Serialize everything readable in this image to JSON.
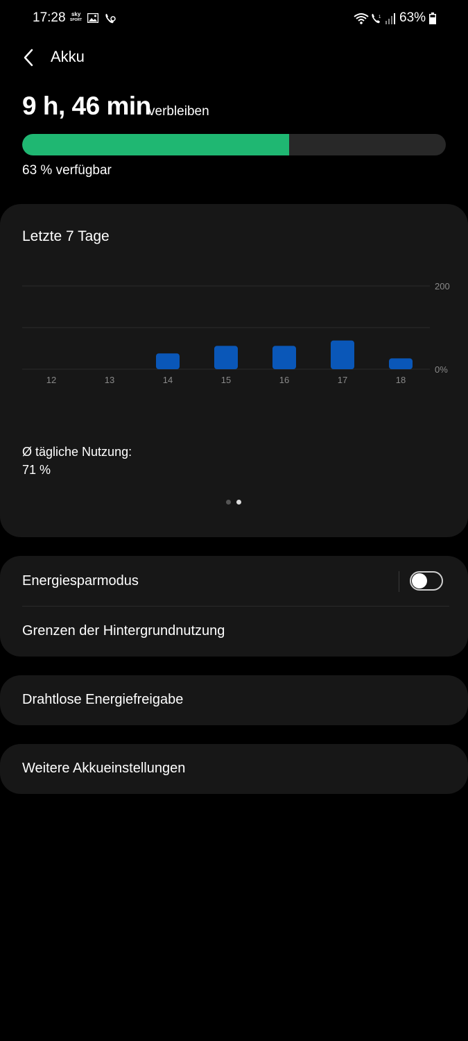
{
  "status_bar": {
    "time": "17:28",
    "sky_top": "sky",
    "sky_bottom": "SPORT",
    "battery_percent": "63%",
    "icons": [
      "image-icon",
      "wifi-call-icon",
      "wifi-icon",
      "volte-icon",
      "signal-icon",
      "battery-icon"
    ]
  },
  "header": {
    "title": "Akku",
    "back_icon": "chevron-left-icon"
  },
  "battery": {
    "remaining_time": "9 h, 46 min",
    "remaining_suffix": "verbleiben",
    "level_percent": 63,
    "available_text": "63 % verfügbar",
    "fill_color": "#1fb772"
  },
  "usage_card": {
    "title": "Letzte 7 Tage",
    "avg_label": "Ø tägliche Nutzung:",
    "avg_value": "71 %",
    "page_indicator": {
      "count": 2,
      "active": 2
    }
  },
  "chart_data": {
    "type": "bar",
    "categories": [
      "12",
      "13",
      "14",
      "15",
      "16",
      "17",
      "18"
    ],
    "values": [
      0,
      0,
      38,
      56,
      56,
      69,
      26
    ],
    "y_tick_labels": [
      "200",
      "0%"
    ],
    "ylim": [
      0,
      200
    ],
    "grid": true,
    "bar_color": "#0a57b8"
  },
  "settings": {
    "power_saving_label": "Energiesparmodus",
    "power_saving_enabled": false,
    "background_limits_label": "Grenzen der Hintergrundnutzung",
    "wireless_share_label": "Drahtlose Energiefreigabe",
    "more_settings_label": "Weitere Akkueinstellungen"
  }
}
